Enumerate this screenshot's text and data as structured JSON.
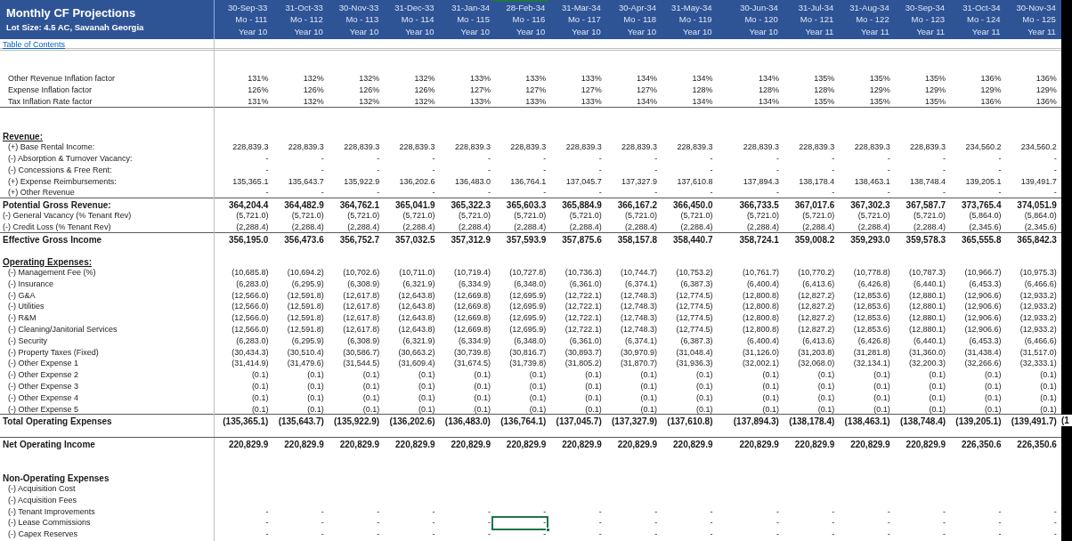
{
  "title": "Monthly CF Projections",
  "subtitle": "Lot Size: 4.5 AC, Savanah Georgia",
  "columns": [
    {
      "date": "30-Sep-33",
      "month": "Mo - 111",
      "year": "Year 10"
    },
    {
      "date": "31-Oct-33",
      "month": "Mo - 112",
      "year": "Year 10"
    },
    {
      "date": "30-Nov-33",
      "month": "Mo - 113",
      "year": "Year 10"
    },
    {
      "date": "31-Dec-33",
      "month": "Mo - 114",
      "year": "Year 10"
    },
    {
      "date": "31-Jan-34",
      "month": "Mo - 115",
      "year": "Year 10"
    },
    {
      "date": "28-Feb-34",
      "month": "Mo - 116",
      "year": "Year 10"
    },
    {
      "date": "31-Mar-34",
      "month": "Mo - 117",
      "year": "Year 10"
    },
    {
      "date": "30-Apr-34",
      "month": "Mo - 118",
      "year": "Year 10"
    },
    {
      "date": "31-May-34",
      "month": "Mo - 119",
      "year": "Year 10"
    },
    {
      "date": "30-Jun-34",
      "month": "Mo - 120",
      "year": "Year 10"
    },
    {
      "date": "31-Jul-34",
      "month": "Mo - 121",
      "year": "Year 11"
    },
    {
      "date": "31-Aug-34",
      "month": "Mo - 122",
      "year": "Year 11"
    },
    {
      "date": "30-Sep-34",
      "month": "Mo - 123",
      "year": "Year 11"
    },
    {
      "date": "31-Oct-34",
      "month": "Mo - 124",
      "year": "Year 11"
    },
    {
      "date": "30-Nov-34",
      "month": "Mo - 125",
      "year": "Year 11"
    }
  ],
  "toc_link": "Table of Contents",
  "blocks": [
    {
      "rows": [
        {
          "kind": "spacer"
        },
        {
          "kind": "spacer"
        },
        {
          "kind": "item",
          "label": "Other Revenue Inflation factor",
          "values": [
            "131%",
            "132%",
            "132%",
            "132%",
            "133%",
            "133%",
            "133%",
            "134%",
            "134%",
            "134%",
            "135%",
            "135%",
            "135%",
            "136%",
            "136%"
          ],
          "selected_cells": [
            false,
            false,
            false,
            false,
            false,
            false,
            false,
            false,
            false,
            false,
            false,
            false,
            false,
            false,
            false
          ]
        },
        {
          "kind": "item",
          "label": "Expense Inflation factor",
          "values": [
            "126%",
            "126%",
            "126%",
            "126%",
            "127%",
            "127%",
            "127%",
            "127%",
            "128%",
            "128%",
            "128%",
            "129%",
            "129%",
            "129%",
            "129%"
          ],
          "selected_cells": [
            false,
            false,
            false,
            false,
            false,
            false,
            false,
            false,
            false,
            false,
            false,
            false,
            false,
            false,
            false
          ]
        },
        {
          "kind": "item",
          "label": "Tax Inflation Rate factor",
          "values": [
            "131%",
            "132%",
            "132%",
            "132%",
            "133%",
            "133%",
            "133%",
            "134%",
            "134%",
            "134%",
            "135%",
            "135%",
            "135%",
            "136%",
            "136%"
          ],
          "selected_cells": [
            false,
            false,
            false,
            false,
            false,
            false,
            false,
            false,
            false,
            false,
            false,
            false,
            false,
            false,
            false
          ]
        }
      ]
    },
    {
      "rows": [
        {
          "kind": "spacer"
        },
        {
          "kind": "spacer"
        },
        {
          "kind": "section",
          "label": "Revenue:"
        },
        {
          "kind": "item",
          "label": "(+) Base Rental Income:",
          "values": [
            "228,839.3",
            "228,839.3",
            "228,839.3",
            "228,839.3",
            "228,839.3",
            "228,839.3",
            "228,839.3",
            "228,839.3",
            "228,839.3",
            "228,839.3",
            "228,839.3",
            "228,839.3",
            "228,839.3",
            "234,560.2",
            "234,560.2"
          ],
          "selected_cells": [
            false,
            false,
            false,
            false,
            false,
            false,
            false,
            false,
            false,
            false,
            false,
            false,
            false,
            false,
            false
          ]
        },
        {
          "kind": "item",
          "label": "(-) Absorption & Turnover Vacancy:",
          "values": [
            "-",
            "-",
            "-",
            "-",
            "-",
            "-",
            "-",
            "-",
            "-",
            "-",
            "-",
            "-",
            "-",
            "-",
            "-"
          ],
          "selected_cells": [
            false,
            false,
            false,
            false,
            false,
            false,
            false,
            false,
            false,
            false,
            false,
            false,
            false,
            false,
            false
          ]
        },
        {
          "kind": "item",
          "label": "(-) Concessions & Free Rent:",
          "values": [
            "-",
            "-",
            "-",
            "-",
            "-",
            "-",
            "-",
            "-",
            "-",
            "-",
            "-",
            "-",
            "-",
            "-",
            "-"
          ],
          "selected_cells": [
            false,
            false,
            false,
            false,
            false,
            false,
            false,
            false,
            false,
            false,
            false,
            false,
            false,
            false,
            false
          ]
        },
        {
          "kind": "item",
          "label": "(+) Expense Reimbursements:",
          "values": [
            "135,365.1",
            "135,643.7",
            "135,922.9",
            "136,202.6",
            "136,483.0",
            "136,764.1",
            "137,045.7",
            "137,327.9",
            "137,610.8",
            "137,894.3",
            "138,178.4",
            "138,463.1",
            "138,748.4",
            "139,205.1",
            "139,491.7"
          ],
          "selected_cells": [
            false,
            false,
            false,
            false,
            false,
            false,
            false,
            false,
            false,
            false,
            false,
            false,
            false,
            false,
            false
          ]
        },
        {
          "kind": "item",
          "label": "(+) Other Revenue",
          "values": [
            "-",
            "-",
            "-",
            "-",
            "-",
            "-",
            "-",
            "-",
            "-",
            "-",
            "-",
            "-",
            "-",
            "-",
            "-"
          ],
          "selected_cells": [
            false,
            false,
            false,
            false,
            false,
            false,
            false,
            false,
            false,
            false,
            false,
            false,
            false,
            false,
            false
          ]
        }
      ]
    },
    {
      "rows": [
        {
          "kind": "total",
          "label": "Potential Gross Revenue:",
          "values": [
            "364,204.4",
            "364,482.9",
            "364,762.1",
            "365,041.9",
            "365,322.3",
            "365,603.3",
            "365,884.9",
            "366,167.2",
            "366,450.0",
            "366,733.5",
            "367,017.6",
            "367,302.3",
            "367,587.7",
            "373,765.4",
            "374,051.9"
          ],
          "selected_cells": [
            false,
            false,
            false,
            false,
            false,
            false,
            false,
            false,
            false,
            false,
            false,
            false,
            false,
            false,
            false
          ]
        },
        {
          "kind": "adjustment",
          "label": "(-) General Vacancy (% Tenant Rev)",
          "values": [
            "(5,721.0)",
            "(5,721.0)",
            "(5,721.0)",
            "(5,721.0)",
            "(5,721.0)",
            "(5,721.0)",
            "(5,721.0)",
            "(5,721.0)",
            "(5,721.0)",
            "(5,721.0)",
            "(5,721.0)",
            "(5,721.0)",
            "(5,721.0)",
            "(5,864.0)",
            "(5,864.0)"
          ],
          "selected_cells": [
            false,
            false,
            false,
            false,
            false,
            false,
            false,
            false,
            false,
            false,
            false,
            false,
            false,
            false,
            false
          ]
        },
        {
          "kind": "adjustment",
          "label": "(-) Credit Loss (% Tenant Rev)",
          "values": [
            "(2,288.4)",
            "(2,288.4)",
            "(2,288.4)",
            "(2,288.4)",
            "(2,288.4)",
            "(2,288.4)",
            "(2,288.4)",
            "(2,288.4)",
            "(2,288.4)",
            "(2,288.4)",
            "(2,288.4)",
            "(2,288.4)",
            "(2,288.4)",
            "(2,345.6)",
            "(2,345.6)"
          ],
          "selected_cells": [
            false,
            false,
            false,
            false,
            false,
            false,
            false,
            false,
            false,
            false,
            false,
            false,
            false,
            false,
            false
          ]
        }
      ]
    },
    {
      "rows": [
        {
          "kind": "total",
          "label": "Effective Gross Income",
          "values": [
            "356,195.0",
            "356,473.6",
            "356,752.7",
            "357,032.5",
            "357,312.9",
            "357,593.9",
            "357,875.6",
            "358,157.8",
            "358,440.7",
            "358,724.1",
            "359,008.2",
            "359,293.0",
            "359,578.3",
            "365,555.8",
            "365,842.3"
          ],
          "selected_cells": [
            false,
            false,
            false,
            false,
            false,
            false,
            false,
            false,
            false,
            false,
            false,
            false,
            false,
            false,
            false
          ]
        },
        {
          "kind": "spacer"
        },
        {
          "kind": "section",
          "label": "Operating Expenses:"
        },
        {
          "kind": "item",
          "label": "(-) Management Fee (%)",
          "values": [
            "(10,685.8)",
            "(10,694.2)",
            "(10,702.6)",
            "(10,711.0)",
            "(10,719.4)",
            "(10,727.8)",
            "(10,736.3)",
            "(10,744.7)",
            "(10,753.2)",
            "(10,761.7)",
            "(10,770.2)",
            "(10,778.8)",
            "(10,787.3)",
            "(10,966.7)",
            "(10,975.3)"
          ],
          "selected_cells": [
            false,
            false,
            false,
            false,
            false,
            false,
            false,
            false,
            false,
            false,
            false,
            false,
            false,
            false,
            false
          ]
        },
        {
          "kind": "item",
          "label": "(-) Insurance",
          "values": [
            "(6,283.0)",
            "(6,295.9)",
            "(6,308.9)",
            "(6,321.9)",
            "(6,334.9)",
            "(6,348.0)",
            "(6,361.0)",
            "(6,374.1)",
            "(6,387.3)",
            "(6,400.4)",
            "(6,413.6)",
            "(6,426.8)",
            "(6,440.1)",
            "(6,453.3)",
            "(6,466.6)"
          ],
          "selected_cells": [
            false,
            false,
            false,
            false,
            false,
            false,
            false,
            false,
            false,
            false,
            false,
            false,
            false,
            false,
            false
          ]
        },
        {
          "kind": "item",
          "label": "(-) G&A",
          "values": [
            "(12,566.0)",
            "(12,591.8)",
            "(12,617.8)",
            "(12,643.8)",
            "(12,669.8)",
            "(12,695.9)",
            "(12,722.1)",
            "(12,748.3)",
            "(12,774.5)",
            "(12,800.8)",
            "(12,827.2)",
            "(12,853.6)",
            "(12,880.1)",
            "(12,906.6)",
            "(12,933.2)"
          ],
          "selected_cells": [
            false,
            false,
            false,
            false,
            false,
            false,
            false,
            false,
            false,
            false,
            false,
            false,
            false,
            false,
            false
          ]
        },
        {
          "kind": "item",
          "label": "(-) Utilities",
          "values": [
            "(12,566.0)",
            "(12,591.8)",
            "(12,617.8)",
            "(12,643.8)",
            "(12,669.8)",
            "(12,695.9)",
            "(12,722.1)",
            "(12,748.3)",
            "(12,774.5)",
            "(12,800.8)",
            "(12,827.2)",
            "(12,853.6)",
            "(12,880.1)",
            "(12,906.6)",
            "(12,933.2)"
          ],
          "selected_cells": [
            false,
            false,
            false,
            false,
            false,
            false,
            false,
            false,
            false,
            false,
            false,
            false,
            false,
            false,
            false
          ]
        },
        {
          "kind": "item",
          "label": "(-) R&M",
          "values": [
            "(12,566.0)",
            "(12,591.8)",
            "(12,617.8)",
            "(12,643.8)",
            "(12,669.8)",
            "(12,695.9)",
            "(12,722.1)",
            "(12,748.3)",
            "(12,774.5)",
            "(12,800.8)",
            "(12,827.2)",
            "(12,853.6)",
            "(12,880.1)",
            "(12,906.6)",
            "(12,933.2)"
          ],
          "selected_cells": [
            false,
            false,
            false,
            false,
            false,
            false,
            false,
            false,
            false,
            false,
            false,
            false,
            false,
            false,
            false
          ]
        },
        {
          "kind": "item",
          "label": "(-) Cleaning/Janitorial Services",
          "values": [
            "(12,566.0)",
            "(12,591.8)",
            "(12,617.8)",
            "(12,643.8)",
            "(12,669.8)",
            "(12,695.9)",
            "(12,722.1)",
            "(12,748.3)",
            "(12,774.5)",
            "(12,800.8)",
            "(12,827.2)",
            "(12,853.6)",
            "(12,880.1)",
            "(12,906.6)",
            "(12,933.2)"
          ],
          "selected_cells": [
            false,
            false,
            false,
            false,
            false,
            false,
            false,
            false,
            false,
            false,
            false,
            false,
            false,
            false,
            false
          ]
        },
        {
          "kind": "item",
          "label": "(-) Security",
          "values": [
            "(6,283.0)",
            "(6,295.9)",
            "(6,308.9)",
            "(6,321.9)",
            "(6,334.9)",
            "(6,348.0)",
            "(6,361.0)",
            "(6,374.1)",
            "(6,387.3)",
            "(6,400.4)",
            "(6,413.6)",
            "(6,426.8)",
            "(6,440.1)",
            "(6,453.3)",
            "(6,466.6)"
          ],
          "selected_cells": [
            false,
            false,
            false,
            false,
            false,
            false,
            false,
            false,
            false,
            false,
            false,
            false,
            false,
            false,
            false
          ]
        },
        {
          "kind": "item",
          "label": "(-) Property Taxes (Fixed)",
          "values": [
            "(30,434.3)",
            "(30,510.4)",
            "(30,586.7)",
            "(30,663.2)",
            "(30,739.8)",
            "(30,816.7)",
            "(30,893.7)",
            "(30,970.9)",
            "(31,048.4)",
            "(31,126.0)",
            "(31,203.8)",
            "(31,281.8)",
            "(31,360.0)",
            "(31,438.4)",
            "(31,517.0)"
          ],
          "selected_cells": [
            false,
            false,
            false,
            false,
            false,
            false,
            false,
            false,
            false,
            false,
            false,
            false,
            false,
            false,
            false
          ]
        },
        {
          "kind": "item",
          "label": "(-) Other Expense 1",
          "values": [
            "(31,414.9)",
            "(31,479.6)",
            "(31,544.5)",
            "(31,609.4)",
            "(31,674.5)",
            "(31,739.8)",
            "(31,805.2)",
            "(31,870.7)",
            "(31,936.3)",
            "(32,002.1)",
            "(32,068.0)",
            "(32,134.1)",
            "(32,200.3)",
            "(32,266.6)",
            "(32,333.1)"
          ],
          "selected_cells": [
            false,
            false,
            false,
            false,
            false,
            false,
            false,
            false,
            false,
            false,
            false,
            false,
            false,
            false,
            false
          ]
        },
        {
          "kind": "item",
          "label": "(-) Other Expense 2",
          "values": [
            "(0.1)",
            "(0.1)",
            "(0.1)",
            "(0.1)",
            "(0.1)",
            "(0.1)",
            "(0.1)",
            "(0.1)",
            "(0.1)",
            "(0.1)",
            "(0.1)",
            "(0.1)",
            "(0.1)",
            "(0.1)",
            "(0.1)"
          ],
          "selected_cells": [
            false,
            false,
            false,
            false,
            false,
            false,
            false,
            false,
            false,
            false,
            false,
            false,
            false,
            false,
            false
          ]
        },
        {
          "kind": "item",
          "label": "(-) Other Expense 3",
          "values": [
            "(0.1)",
            "(0.1)",
            "(0.1)",
            "(0.1)",
            "(0.1)",
            "(0.1)",
            "(0.1)",
            "(0.1)",
            "(0.1)",
            "(0.1)",
            "(0.1)",
            "(0.1)",
            "(0.1)",
            "(0.1)",
            "(0.1)"
          ],
          "selected_cells": [
            false,
            false,
            false,
            false,
            false,
            false,
            false,
            false,
            false,
            false,
            false,
            false,
            false,
            false,
            false
          ]
        },
        {
          "kind": "item",
          "label": "(-) Other Expense 4",
          "values": [
            "(0.1)",
            "(0.1)",
            "(0.1)",
            "(0.1)",
            "(0.1)",
            "(0.1)",
            "(0.1)",
            "(0.1)",
            "(0.1)",
            "(0.1)",
            "(0.1)",
            "(0.1)",
            "(0.1)",
            "(0.1)",
            "(0.1)"
          ],
          "selected_cells": [
            false,
            false,
            false,
            false,
            false,
            false,
            false,
            false,
            false,
            false,
            false,
            false,
            false,
            false,
            false
          ]
        },
        {
          "kind": "item",
          "label": "(-) Other Expense 5",
          "values": [
            "(0.1)",
            "(0.1)",
            "(0.1)",
            "(0.1)",
            "(0.1)",
            "(0.1)",
            "(0.1)",
            "(0.1)",
            "(0.1)",
            "(0.1)",
            "(0.1)",
            "(0.1)",
            "(0.1)",
            "(0.1)",
            "(0.1)"
          ],
          "selected_cells": [
            false,
            false,
            false,
            false,
            false,
            false,
            false,
            false,
            false,
            false,
            false,
            false,
            false,
            false,
            false
          ]
        }
      ]
    },
    {
      "rows": [
        {
          "kind": "total",
          "label": "Total Operating Expenses",
          "values": [
            "(135,365.1)",
            "(135,643.7)",
            "(135,922.9)",
            "(136,202.6)",
            "(136,483.0)",
            "(136,764.1)",
            "(137,045.7)",
            "(137,327.9)",
            "(137,610.8)",
            "(137,894.3)",
            "(138,178.4)",
            "(138,463.1)",
            "(138,748.4)",
            "(139,205.1)",
            "(139,491.7)"
          ],
          "overflow_text": "(1",
          "selected_cells": [
            false,
            false,
            false,
            false,
            false,
            false,
            false,
            false,
            false,
            false,
            false,
            false,
            false,
            false,
            false
          ]
        },
        {
          "kind": "spacer"
        }
      ]
    },
    {
      "rows": [
        {
          "kind": "total",
          "label": "Net Operating Income",
          "values": [
            "220,829.9",
            "220,829.9",
            "220,829.9",
            "220,829.9",
            "220,829.9",
            "220,829.9",
            "220,829.9",
            "220,829.9",
            "220,829.9",
            "220,829.9",
            "220,829.9",
            "220,829.9",
            "220,829.9",
            "226,350.6",
            "226,350.6"
          ],
          "selected_cells": [
            false,
            false,
            false,
            false,
            false,
            false,
            false,
            false,
            false,
            false,
            false,
            false,
            false,
            false,
            false
          ]
        },
        {
          "kind": "spacer"
        },
        {
          "kind": "spacer"
        },
        {
          "kind": "plain_section",
          "label": "Non-Operating Expenses"
        },
        {
          "kind": "item",
          "label": "(-) Acquisition Cost"
        },
        {
          "kind": "item",
          "label": "(-) Acquisition Fees"
        },
        {
          "kind": "item",
          "label": "(-) Tenant Improvements",
          "values": [
            "-",
            "-",
            "-",
            "-",
            "-",
            "-",
            "-",
            "-",
            "-",
            "-",
            "-",
            "-",
            "-",
            "-",
            "-"
          ],
          "selected_cells": [
            false,
            false,
            false,
            false,
            false,
            false,
            false,
            false,
            false,
            false,
            false,
            false,
            false,
            false,
            false
          ]
        },
        {
          "kind": "item",
          "label": "(-) Lease Commissions",
          "values": [
            "-",
            "-",
            "-",
            "-",
            "-",
            "-",
            "-",
            "-",
            "-",
            "-",
            "-",
            "-",
            "-",
            "-",
            "-"
          ],
          "selected_cells": [
            false,
            false,
            false,
            false,
            false,
            true,
            false,
            false,
            false,
            false,
            false,
            false,
            false,
            false,
            false
          ]
        },
        {
          "kind": "item",
          "label": "(-) Capex Reserves",
          "values": [
            "-",
            "-",
            "-",
            "-",
            "-",
            "-",
            "-",
            "-",
            "-",
            "-",
            "-",
            "-",
            "-",
            "-",
            "-"
          ],
          "selected_cells": [
            false,
            false,
            false,
            false,
            false,
            false,
            false,
            false,
            false,
            false,
            false,
            false,
            false,
            false,
            false
          ]
        }
      ]
    }
  ]
}
